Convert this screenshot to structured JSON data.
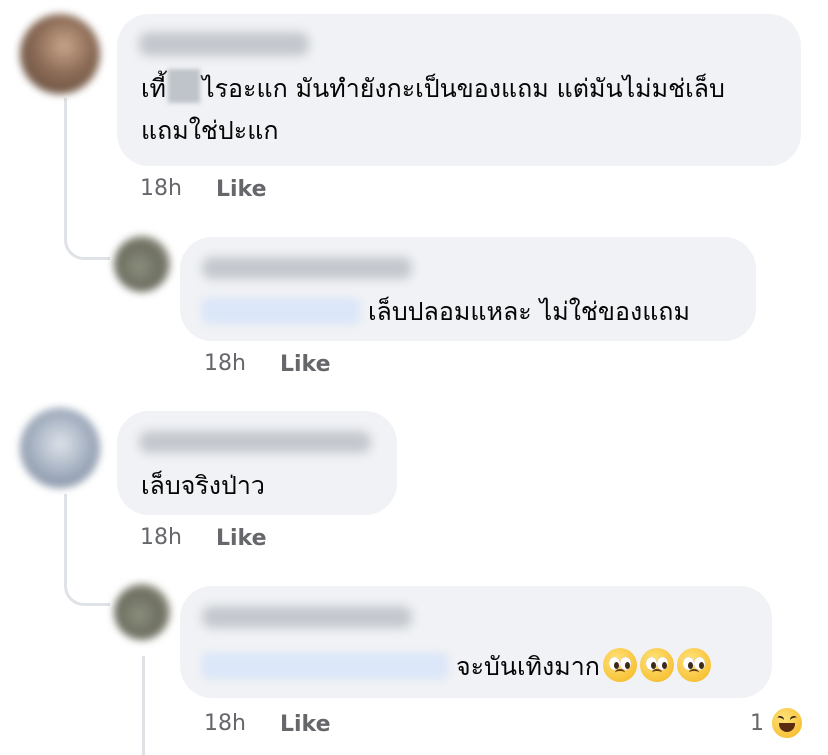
{
  "comments": [
    {
      "text_before": "เที้",
      "text_after": "ไรอะแก มันทำยังกะเป็นของแถม แต่มันไม่มช่เล็บ",
      "text_line2": "แถมใช่ปะแก",
      "time": "18h",
      "like": "Like",
      "replies": [
        {
          "text": "เล็บปลอมแหละ ไม่ใช่ของแถม",
          "time": "18h",
          "like": "Like"
        }
      ]
    },
    {
      "text": "เล็บจริงป่าว",
      "time": "18h",
      "like": "Like",
      "replies": [
        {
          "text": "จะบันเทิงมาก",
          "emoji": [
            "pleading-face-emoji",
            "pleading-face-emoji",
            "pleading-face-emoji"
          ],
          "time": "18h",
          "like": "Like",
          "reaction_count": "1",
          "reaction_icon": "laughing-face-emoji"
        }
      ]
    }
  ],
  "colors": {
    "bubble": "#f0f2f5",
    "meta_text": "#65676b",
    "thread_line": "#dfe2e6"
  }
}
